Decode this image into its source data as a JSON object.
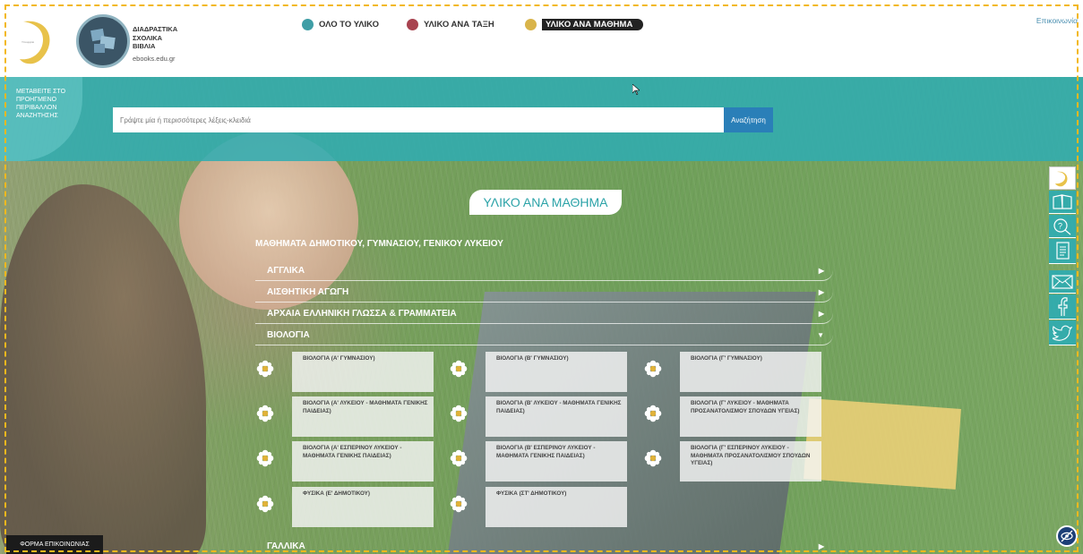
{
  "header": {
    "brand_lines": [
      "ΔΙΑΔΡΑΣΤΙΚΑ",
      "ΣΧΟΛΙΚΑ",
      "ΒΙΒΛΙΑ"
    ],
    "brand_url": "ebooks.edu.gr",
    "contact_link": "Επικοινωνία",
    "nav": [
      {
        "label": "ΟΛΟ ΤΟ ΥΛΙΚΟ",
        "color": "#3f9ea6"
      },
      {
        "label": "ΥΛΙΚΟ ΑΝΑ ΤΑΞΗ",
        "color": "#a8434f"
      },
      {
        "label": "ΥΛΙΚΟ ΑΝΑ ΜΑΘΗΜΑ",
        "color": "#d9b44a"
      }
    ]
  },
  "search": {
    "advanced_text": "ΜΕΤΑΒΕΙΤΕ ΣΤΟ ΠΡΟΗΓΜΕΝΟ ΠΕΡΙΒΑΛΛΟΝ ΑΝΑΖΗΤΗΣΗΣ",
    "placeholder": "Γράψτε μία ή περισσότερες λέξεις-κλειδιά",
    "button": "Αναζήτηση"
  },
  "main": {
    "section_title": "ΥΛΙΚΟ ΑΝΑ ΜΑΘΗΜΑ",
    "group_title": "ΜΑΘΗΜΑΤΑ ΔΗΜΟΤΙΚΟΥ, ΓΥΜΝΑΣΙΟΥ, ΓΕΝΙΚΟΥ ΛΥΚΕΙΟΥ",
    "categories": [
      {
        "label": "ΑΓΓΛΙΚΑ",
        "arrow": "▶"
      },
      {
        "label": "ΑΙΣΘΗΤΙΚΗ ΑΓΩΓΗ",
        "arrow": "▶"
      },
      {
        "label": "ΑΡΧΑΙΑ ΕΛΛΗΝΙΚΗ ΓΛΩΣΣΑ & ΓΡΑΜΜΑΤΕΙΑ",
        "arrow": "▶"
      },
      {
        "label": "ΒΙΟΛΟΓΙΑ",
        "arrow": "▼"
      }
    ],
    "books": [
      "ΒΙΟΛΟΓΙΑ (Α' ΓΥΜΝΑΣΙΟΥ)",
      "ΒΙΟΛΟΓΙΑ (Β' ΓΥΜΝΑΣΙΟΥ)",
      "ΒΙΟΛΟΓΙΑ (Γ' ΓΥΜΝΑΣΙΟΥ)",
      "ΒΙΟΛΟΓΙΑ (Α' ΛΥΚΕΙΟΥ - ΜΑΘΗΜΑΤΑ ΓΕΝΙΚΗΣ ΠΑΙΔΕΙΑΣ)",
      "ΒΙΟΛΟΓΙΑ (Β' ΛΥΚΕΙΟΥ - ΜΑΘΗΜΑΤΑ ΓΕΝΙΚΗΣ ΠΑΙΔΕΙΑΣ)",
      "ΒΙΟΛΟΓΙΑ (Γ' ΛΥΚΕΙΟΥ - ΜΑΘΗΜΑΤΑ ΠΡΟΣΑΝΑΤΟΛΙΣΜΟΥ ΣΠΟΥΔΩΝ ΥΓΕΙΑΣ)",
      "ΒΙΟΛΟΓΙΑ (Α' ΕΣΠΕΡΙΝΟΥ ΛΥΚΕΙΟΥ - ΜΑΘΗΜΑΤΑ ΓΕΝΙΚΗΣ ΠΑΙΔΕΙΑΣ)",
      "ΒΙΟΛΟΓΙΑ (Β' ΕΣΠΕΡΙΝΟΥ ΛΥΚΕΙΟΥ - ΜΑΘΗΜΑΤΑ ΓΕΝΙΚΗΣ ΠΑΙΔΕΙΑΣ)",
      "ΒΙΟΛΟΓΙΑ (Γ' ΕΣΠΕΡΙΝΟΥ ΛΥΚΕΙΟΥ - ΜΑΘΗΜΑΤΑ ΠΡΟΣΑΝΑΤΟΛΙΣΜΟΥ ΣΠΟΥΔΩΝ ΥΓΕΙΑΣ)",
      "ΦΥΣΙΚΑ (Ε' ΔΗΜΟΤΙΚΟΥ)",
      "ΦΥΣΙΚΑ (ΣΤ' ΔΗΜΟΤΙΚΟΥ)"
    ],
    "next_category": {
      "label": "ΓΑΛΛΙΚΑ",
      "arrow": "▶"
    }
  },
  "side_icons": [
    "logo-icon",
    "book-icon",
    "help-icon",
    "document-icon",
    "mail-icon",
    "facebook-icon",
    "twitter-icon"
  ],
  "footer": {
    "contact_form": "ΦΟΡΜΑ ΕΠΙΚΟΙΝΩΝΙΑΣ"
  }
}
